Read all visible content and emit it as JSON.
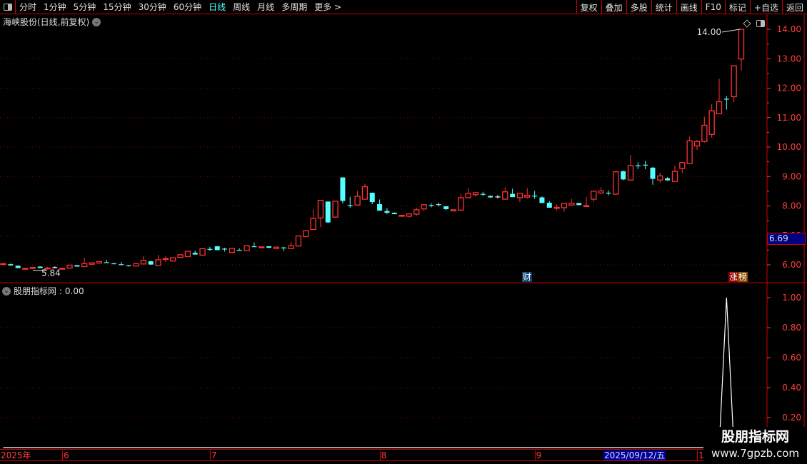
{
  "toolbar": {
    "periods": [
      "分时",
      "1分钟",
      "5分钟",
      "15分钟",
      "30分钟",
      "60分钟",
      "日线",
      "周线",
      "月线",
      "多周期",
      "更多 >"
    ],
    "active": "日线",
    "buttons": [
      "复权",
      "叠加",
      "多股",
      "统计",
      "画线",
      "F10",
      "标记",
      "+自选",
      "返回"
    ]
  },
  "title": "海峡股份(日线,前复权)",
  "indicator": {
    "name": "股朋指标网",
    "value_label": ": 0.00"
  },
  "current_price": "6.69",
  "high_label": "14.00",
  "low_label": "5.84",
  "markers": {
    "cai": "财",
    "zhang": "涨",
    "bang": "榜"
  },
  "time_axis": {
    "labels": [
      {
        "text": "2025年",
        "pos": 0
      },
      {
        "text": "6",
        "pos": 8
      },
      {
        "text": "7",
        "pos": 28
      },
      {
        "text": "8",
        "pos": 51
      },
      {
        "text": "9",
        "pos": 72
      }
    ],
    "selected": "2025/09/12/五",
    "next": "1"
  },
  "watermark": {
    "line1": "股朋指标网",
    "line2": "www.7gpzb.com"
  },
  "colors": {
    "up": "#ff3232",
    "down": "#54ffff",
    "flat": "#ffffff",
    "axis": "#ff3c3c",
    "grid": "#800000",
    "border": "#cc0000"
  },
  "chart_data": {
    "type": "candlestick",
    "price_axis": {
      "ticks": [
        "6.00",
        "7.00",
        "8.00",
        "9.00",
        "10.00",
        "11.00",
        "12.00",
        "13.00",
        "14.00"
      ]
    },
    "indicator_axis": {
      "ticks": [
        "0.20",
        "0.40",
        "0.60",
        "0.80",
        "1.00"
      ]
    },
    "ohlc": [
      [
        6.03,
        6.04,
        6.03,
        6.04
      ],
      [
        6.02,
        6.04,
        5.97,
        5.98
      ],
      [
        5.97,
        5.98,
        5.89,
        5.89
      ],
      [
        5.87,
        5.88,
        5.87,
        5.88
      ],
      [
        5.9,
        5.91,
        5.9,
        5.91
      ],
      [
        5.94,
        5.95,
        5.89,
        5.89
      ],
      [
        5.87,
        5.92,
        5.84,
        5.89
      ],
      [
        5.92,
        5.95,
        5.88,
        5.92
      ],
      [
        5.87,
        5.88,
        5.87,
        5.88
      ],
      [
        5.89,
        6.0,
        5.89,
        5.99
      ],
      [
        5.99,
        5.99,
        5.94,
        5.94
      ],
      [
        5.94,
        6.24,
        5.94,
        6.04
      ],
      [
        6.02,
        6.08,
        6.0,
        6.07
      ],
      [
        6.06,
        6.11,
        6.04,
        6.11
      ],
      [
        6.09,
        6.17,
        6.08,
        6.08
      ],
      [
        6.05,
        6.08,
        6.02,
        6.04
      ],
      [
        6.02,
        6.1,
        6.01,
        6.01
      ],
      [
        5.99,
        5.99,
        5.94,
        5.98
      ],
      [
        5.96,
        6.05,
        5.95,
        6.04
      ],
      [
        6.03,
        6.29,
        6.03,
        6.15
      ],
      [
        6.12,
        6.14,
        6.0,
        6.01
      ],
      [
        5.98,
        6.34,
        5.98,
        6.17
      ],
      [
        6.2,
        6.29,
        6.1,
        6.21
      ],
      [
        6.13,
        6.24,
        6.1,
        6.24
      ],
      [
        6.25,
        6.36,
        6.25,
        6.34
      ],
      [
        6.28,
        6.46,
        6.28,
        6.46
      ],
      [
        6.41,
        6.48,
        6.35,
        6.35
      ],
      [
        6.33,
        6.56,
        6.33,
        6.55
      ],
      [
        6.54,
        6.61,
        6.47,
        6.53
      ],
      [
        6.63,
        6.64,
        6.5,
        6.5
      ],
      [
        6.55,
        6.58,
        6.45,
        6.54
      ],
      [
        6.42,
        6.58,
        6.42,
        6.56
      ],
      [
        6.51,
        6.56,
        6.48,
        6.5
      ],
      [
        6.48,
        6.65,
        6.48,
        6.65
      ],
      [
        6.63,
        6.76,
        6.61,
        6.62
      ],
      [
        6.6,
        6.61,
        6.6,
        6.61
      ],
      [
        6.63,
        6.63,
        6.56,
        6.58
      ],
      [
        6.55,
        6.62,
        6.53,
        6.6
      ],
      [
        6.59,
        6.61,
        6.47,
        6.58
      ],
      [
        6.55,
        6.78,
        6.55,
        6.65
      ],
      [
        6.64,
        6.98,
        6.64,
        6.98
      ],
      [
        6.96,
        7.16,
        6.96,
        7.16
      ],
      [
        7.2,
        7.88,
        7.2,
        7.58
      ],
      [
        7.59,
        8.19,
        7.28,
        8.19
      ],
      [
        8.15,
        8.15,
        7.42,
        7.44
      ],
      [
        7.62,
        8.16,
        7.6,
        8.16
      ],
      [
        8.97,
        8.97,
        8.09,
        8.17
      ],
      [
        8.03,
        8.31,
        7.94,
        8.02
      ],
      [
        8.03,
        8.51,
        8.03,
        8.33
      ],
      [
        8.23,
        8.75,
        8.23,
        8.65
      ],
      [
        8.45,
        8.45,
        8.06,
        8.13
      ],
      [
        8.06,
        8.22,
        7.84,
        7.84
      ],
      [
        7.83,
        7.93,
        7.72,
        7.77
      ],
      [
        7.77,
        7.78,
        7.72,
        7.72
      ],
      [
        7.65,
        7.68,
        7.63,
        7.68
      ],
      [
        7.65,
        7.75,
        7.6,
        7.73
      ],
      [
        7.72,
        7.94,
        7.67,
        7.87
      ],
      [
        7.9,
        8.07,
        7.82,
        8.04
      ],
      [
        8.03,
        8.09,
        7.95,
        8.02
      ],
      [
        8.06,
        8.12,
        7.98,
        8.05
      ],
      [
        7.99,
        7.99,
        7.86,
        7.89
      ],
      [
        7.83,
        7.87,
        7.82,
        7.87
      ],
      [
        7.86,
        8.41,
        7.84,
        8.28
      ],
      [
        8.28,
        8.6,
        8.28,
        8.43
      ],
      [
        8.38,
        8.45,
        8.32,
        8.45
      ],
      [
        8.41,
        8.48,
        8.33,
        8.4
      ],
      [
        8.34,
        8.36,
        8.27,
        8.29
      ],
      [
        8.32,
        8.37,
        8.26,
        8.32
      ],
      [
        8.23,
        8.63,
        8.21,
        8.48
      ],
      [
        8.41,
        8.58,
        8.3,
        8.3
      ],
      [
        8.28,
        8.43,
        8.13,
        8.43
      ],
      [
        8.3,
        8.6,
        8.26,
        8.36
      ],
      [
        8.35,
        8.51,
        8.24,
        8.34
      ],
      [
        8.29,
        8.33,
        8.1,
        8.1
      ],
      [
        8.11,
        8.17,
        7.94,
        7.94
      ],
      [
        7.94,
        8.05,
        7.85,
        7.95
      ],
      [
        7.94,
        8.09,
        7.81,
        8.09
      ],
      [
        8.03,
        8.24,
        8.03,
        8.09
      ],
      [
        8.1,
        8.11,
        8.03,
        8.03
      ],
      [
        8.0,
        8.31,
        7.99,
        8.01
      ],
      [
        8.23,
        8.5,
        8.14,
        8.5
      ],
      [
        8.44,
        8.63,
        8.42,
        8.51
      ],
      [
        8.45,
        8.53,
        8.36,
        8.44
      ],
      [
        8.4,
        9.19,
        8.38,
        9.16
      ],
      [
        9.18,
        9.2,
        8.88,
        8.9
      ],
      [
        8.88,
        9.73,
        8.88,
        9.37
      ],
      [
        9.38,
        9.48,
        9.25,
        9.37
      ],
      [
        9.4,
        9.53,
        9.25,
        9.39
      ],
      [
        9.3,
        9.32,
        8.72,
        8.92
      ],
      [
        8.88,
        9.12,
        8.78,
        9.02
      ],
      [
        8.94,
        8.98,
        8.85,
        8.87
      ],
      [
        8.83,
        9.37,
        8.83,
        9.17
      ],
      [
        9.27,
        9.5,
        9.11,
        9.47
      ],
      [
        9.44,
        10.35,
        9.44,
        10.21
      ],
      [
        10.04,
        10.24,
        9.9,
        10.19
      ],
      [
        10.19,
        11.03,
        10.15,
        10.74
      ],
      [
        10.43,
        11.45,
        10.32,
        11.23
      ],
      [
        11.13,
        12.32,
        11.13,
        11.54
      ],
      [
        11.64,
        11.73,
        11.27,
        11.63
      ],
      [
        11.71,
        12.76,
        11.52,
        12.76
      ],
      [
        12.99,
        14.0,
        12.59,
        14.0
      ]
    ],
    "indicator_values_nonzero": {
      "98": 1.0
    }
  }
}
